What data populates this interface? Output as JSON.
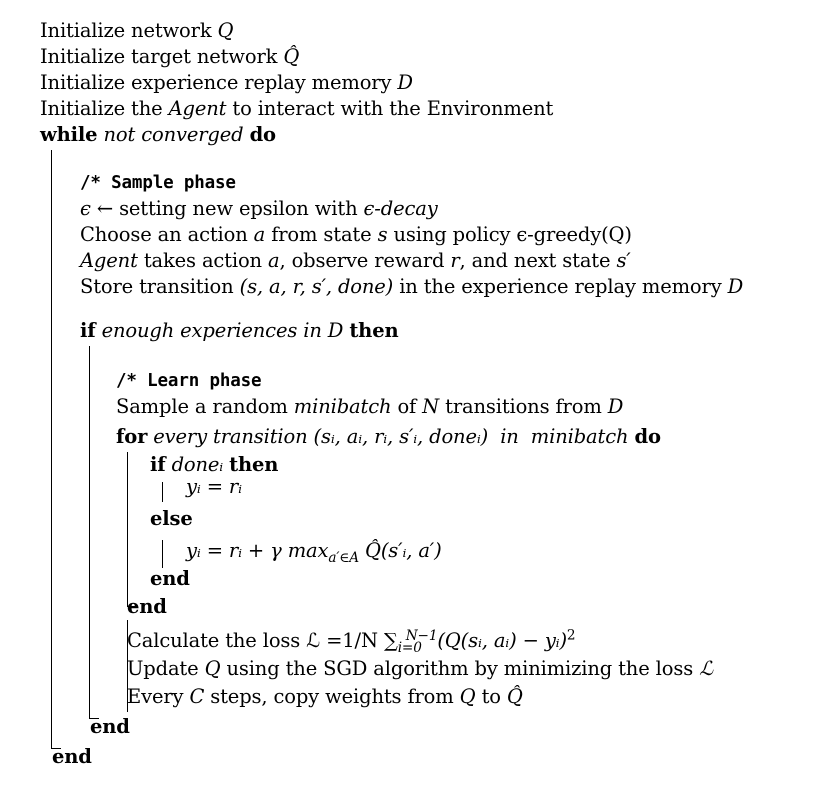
{
  "algorithm": {
    "init": [
      {
        "text": "Initialize network ",
        "math": "Q"
      },
      {
        "text": "Initialize target network ",
        "math": "Q̂"
      },
      {
        "text": "Initialize experience replay memory ",
        "math": "D"
      },
      {
        "text": "Initialize the ",
        "em": "Agent",
        "rest": " to interact with the Environment"
      }
    ],
    "while": {
      "kw": "while",
      "cond": "not converged",
      "do": "do"
    },
    "sample": {
      "comment": "/* Sample phase",
      "l1_math": "ϵ ←",
      "l1_text": " setting new epsilon with ",
      "l1_tail": "ϵ-decay",
      "l2": "Choose an action ",
      "l2_a": "a",
      "l2_b": " from state ",
      "l2_s": "s",
      "l2_c": " using policy ",
      "l2_d": "ϵ-greedy(Q)",
      "l3_em": "Agent",
      "l3": " takes action ",
      "l3_a": "a",
      "l3_b": ", observe reward ",
      "l3_r": "r",
      "l3_c": ", and next state ",
      "l3_s": "s′",
      "l4": "Store transition ",
      "l4_tuple": "(s, a, r, s′, done)",
      "l4_b": " in the experience replay memory ",
      "l4_D": "D"
    },
    "if": {
      "kw": "if",
      "cond": "enough experiences in D",
      "then": "then"
    },
    "learn": {
      "comment": "/* Learn phase",
      "l1": "Sample a random ",
      "l1_em": "minibatch",
      "l1_b": " of ",
      "l1_N": "N",
      "l1_c": " transitions from ",
      "l1_D": "D",
      "for_kw": "for",
      "for_cond": "every transition",
      "for_tuple": "(sᵢ, aᵢ, rᵢ, s′ᵢ, doneᵢ)",
      "for_in": "in",
      "for_mb": "minibatch",
      "for_do": "do",
      "if_kw": "if",
      "if_cond": "doneᵢ",
      "if_then": "then",
      "y1": "yᵢ = rᵢ",
      "else_kw": "else",
      "y2": "yᵢ = rᵢ + γ max",
      "y2_sub": "a′∈A",
      "y2_tail": "Q̂(s′ᵢ, a′)",
      "end_if": "end",
      "end_for": "end",
      "loss": "Calculate the loss ℒ =1/N ∑",
      "loss_sub": "i=0",
      "loss_sup": "N−1",
      "loss_tail": "(Q(sᵢ, aᵢ) − yᵢ)",
      "loss_sq": "2",
      "update": "Update ",
      "update_Q": "Q",
      "update_b": " using the SGD algorithm by minimizing the loss ",
      "update_L": "ℒ",
      "copy": "Every ",
      "copy_C": "C",
      "copy_b": " steps, copy weights from ",
      "copy_Q": "Q",
      "copy_c": " to ",
      "copy_Qh": "Q̂",
      "end_ifblock": "end"
    },
    "end_while": "end"
  }
}
